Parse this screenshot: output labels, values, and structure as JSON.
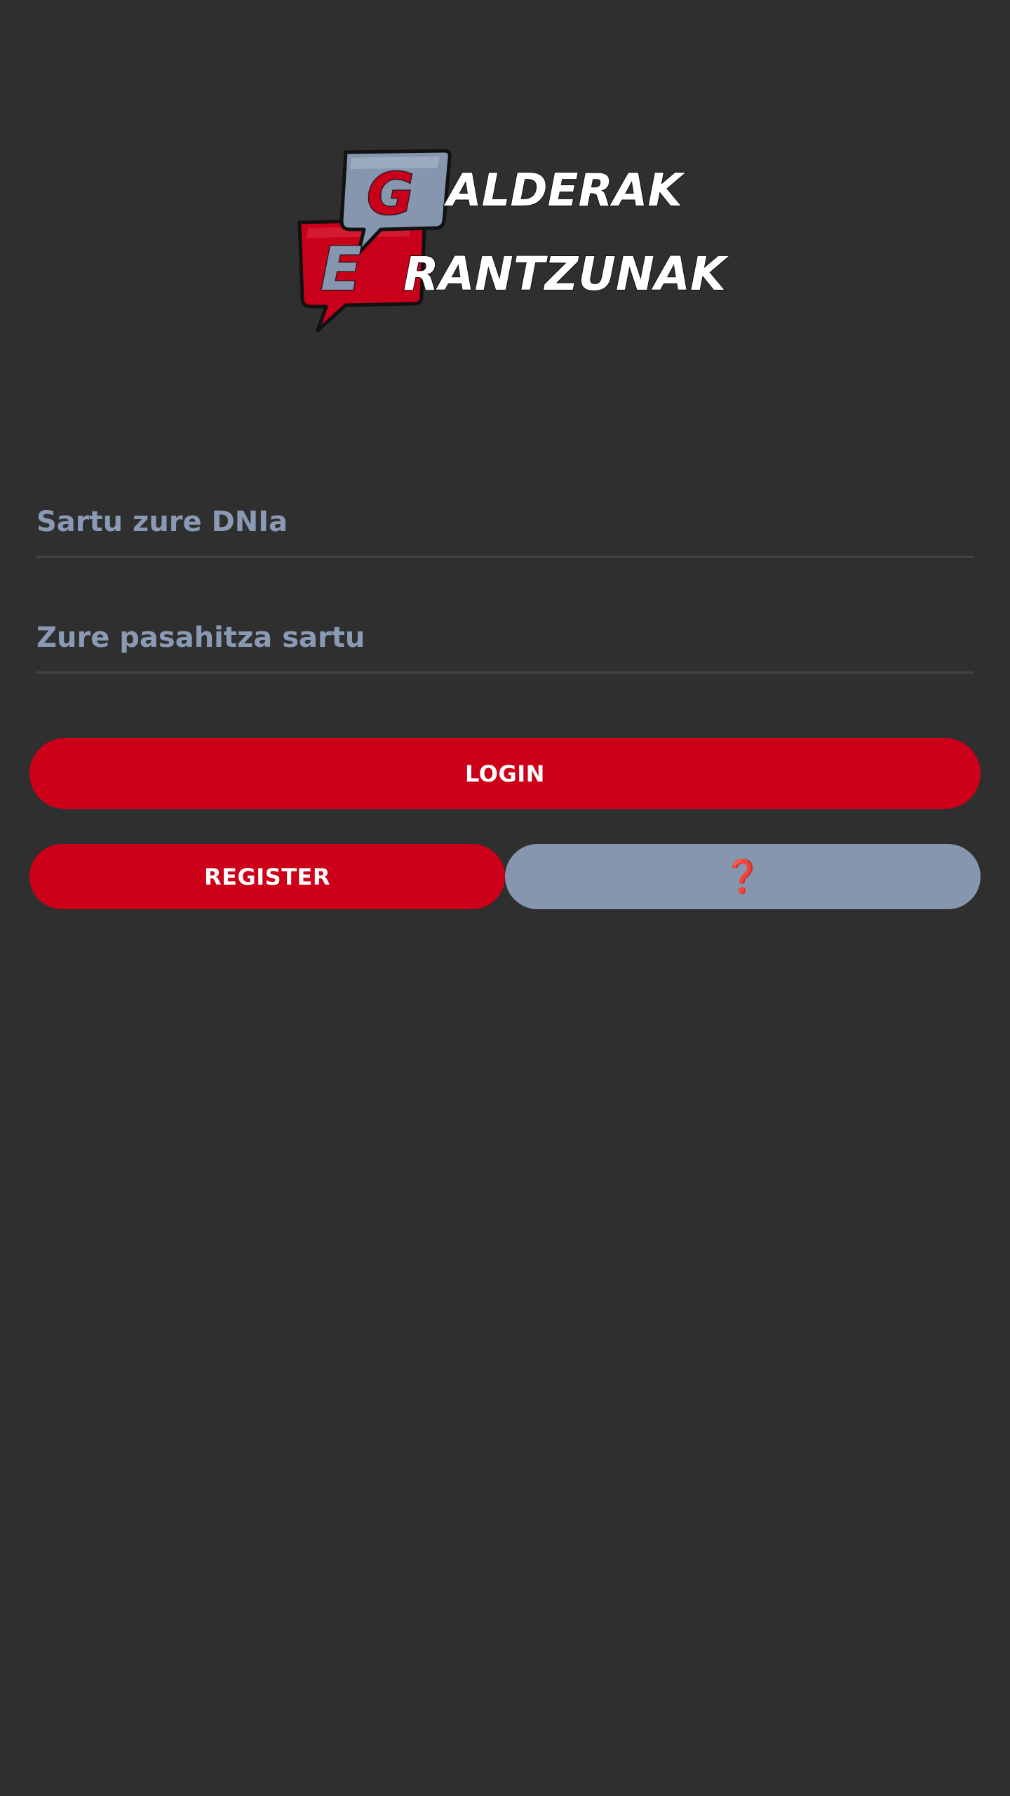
{
  "logo": {
    "letter_g": "G",
    "letter_e": "E",
    "line1": "ALDERAK",
    "line2": "RANTZUNAK",
    "colors": {
      "red": "#c9001a",
      "slate": "#8796af"
    }
  },
  "form": {
    "dni_placeholder": "Sartu zure DNIa",
    "dni_value": "",
    "password_placeholder": "Zure pasahitza sartu",
    "password_value": ""
  },
  "buttons": {
    "login_label": "LOGIN",
    "register_label": "REGISTER",
    "help_label": "❓"
  },
  "colors": {
    "background": "#2f2f2f",
    "primary_red": "#cc0019",
    "secondary_slate": "#8796af",
    "placeholder": "#8a9ab4",
    "field_underline": "#444444"
  }
}
